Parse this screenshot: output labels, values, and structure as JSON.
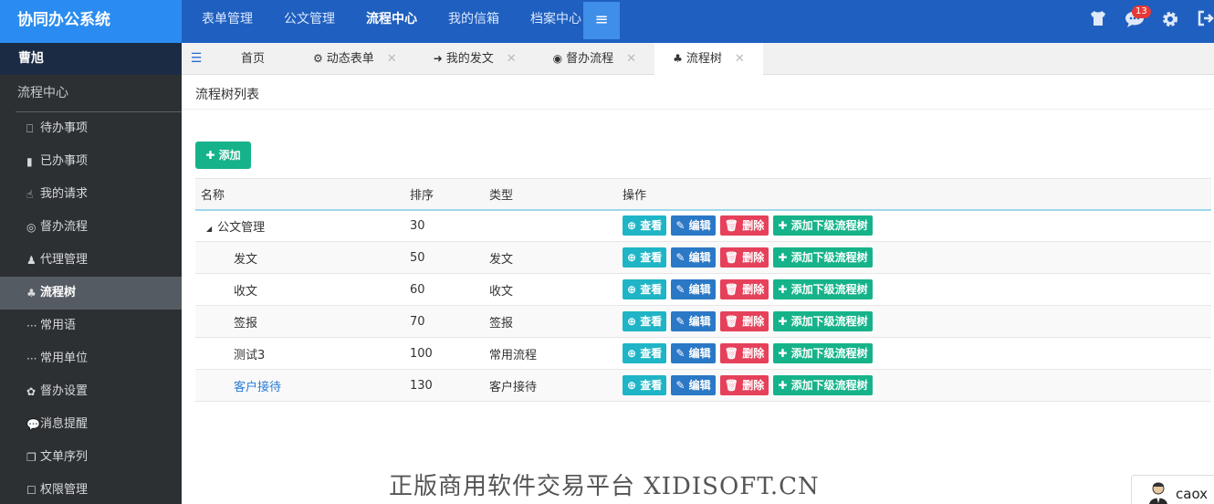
{
  "header": {
    "brand": "协同办公系统",
    "nav": [
      "表单管理",
      "公文管理",
      "流程中心",
      "我的信箱",
      "档案中心"
    ],
    "active_nav": "流程中心",
    "menu_icon": "≡",
    "notification_count": "13",
    "accent_color": "#1f5fbf"
  },
  "sidebar": {
    "user": "曹旭",
    "section": "流程中心",
    "items": [
      {
        "icon": "bookmark-outline-icon",
        "glyph": "⎕",
        "label": "待办事项"
      },
      {
        "icon": "bookmark-icon",
        "glyph": "▮",
        "label": "已办事项"
      },
      {
        "icon": "hand-icon",
        "glyph": "☝",
        "label": "我的请求"
      },
      {
        "icon": "target-icon",
        "glyph": "◎",
        "label": "督办流程"
      },
      {
        "icon": "person-icon",
        "glyph": "♟",
        "label": "代理管理"
      },
      {
        "icon": "tree-icon",
        "glyph": "♣",
        "label": "流程树",
        "active": true
      },
      {
        "icon": "ellipsis-icon",
        "glyph": "···",
        "label": "常用语"
      },
      {
        "icon": "ellipsis-icon",
        "glyph": "···",
        "label": "常用单位"
      },
      {
        "icon": "gear-icon",
        "glyph": "✿",
        "label": "督办设置"
      },
      {
        "icon": "chat-icon",
        "glyph": "💬",
        "label": "消息提醒"
      },
      {
        "icon": "copy-icon",
        "glyph": "❐",
        "label": "文单序列"
      },
      {
        "icon": "square-icon",
        "glyph": "☐",
        "label": "权限管理"
      }
    ]
  },
  "tabs": [
    {
      "label": "首页",
      "glyph": "",
      "closable": false
    },
    {
      "label": "动态表单",
      "glyph": "⚙",
      "closable": true
    },
    {
      "label": "我的发文",
      "glyph": "➜",
      "closable": true
    },
    {
      "label": "督办流程",
      "glyph": "◉",
      "closable": true
    },
    {
      "label": "流程树",
      "glyph": "♣",
      "closable": true,
      "active": true
    }
  ],
  "panel": {
    "title": "流程树列表",
    "add_label": "✚ 添加"
  },
  "table": {
    "headers": [
      "名称",
      "排序",
      "类型",
      "操作"
    ],
    "rows": [
      {
        "name": "公文管理",
        "order": "30",
        "type": "",
        "level": 0
      },
      {
        "name": "发文",
        "order": "50",
        "type": "发文",
        "level": 1
      },
      {
        "name": "收文",
        "order": "60",
        "type": "收文",
        "level": 1
      },
      {
        "name": "签报",
        "order": "70",
        "type": "签报",
        "level": 1
      },
      {
        "name": "测试3",
        "order": "100",
        "type": "常用流程",
        "level": 1
      },
      {
        "name": "客户接待",
        "order": "130",
        "type": "客户接待",
        "level": 1,
        "link": true
      }
    ],
    "actions": {
      "view": "查看",
      "edit": "编辑",
      "delete": "删除",
      "add_child": "添加下级流程树"
    }
  },
  "watermark": "正版商用软件交易平台 XIDISOFT.CN",
  "user_chip": "caox"
}
